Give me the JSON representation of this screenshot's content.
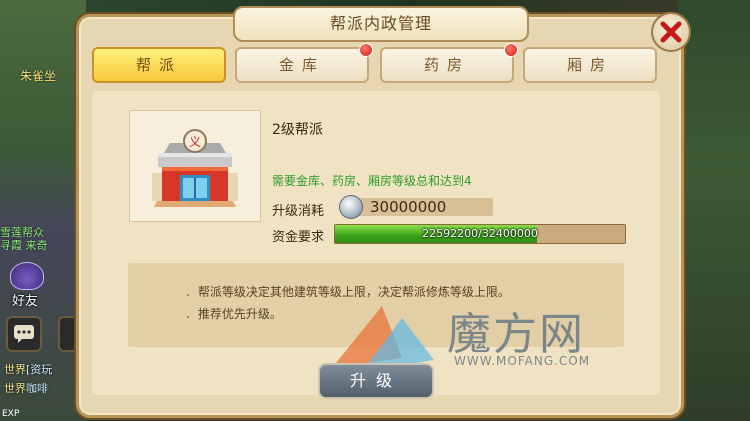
{
  "panel": {
    "title": "帮派内政管理",
    "tabs": [
      {
        "label": "帮派",
        "active": true,
        "has_notification": false
      },
      {
        "label": "金库",
        "active": false,
        "has_notification": true
      },
      {
        "label": "药房",
        "active": false,
        "has_notification": true
      },
      {
        "label": "厢房",
        "active": false,
        "has_notification": false
      }
    ],
    "building": {
      "level_title": "2级帮派",
      "requirement": "需要金库、药房、厢房等级总和达到4",
      "cost_label": "升级消耗",
      "cost_value": "30000000",
      "fund_label": "资金要求",
      "fund_current": 22592200,
      "fund_required": 32400000,
      "fund_text": "22592200/32400000"
    },
    "info": [
      "帮派等级决定其他建筑等级上限，决定帮派修炼等级上限。",
      "推荐优先升级。"
    ],
    "info_bullet": ".",
    "upgrade_label": "升级"
  },
  "hud": {
    "player_name": "朱雀坐",
    "guild_line1": "雪莲帮众",
    "guild_line2": "寻霞 来奇",
    "friend_label": "好友",
    "world_lines": [
      {
        "tag": "世界",
        "msg": "[资玩"
      },
      {
        "tag": "世界",
        "msg": "咖啡"
      }
    ],
    "exp_label": "EXP"
  },
  "watermark": {
    "text": "魔方网",
    "url": "WWW.MOFANG.COM"
  },
  "colors": {
    "accent_gold": "#f6c93a",
    "progress_green": "#3fa81c",
    "requirement_green": "#2e9c2a",
    "notification_red": "#d01818"
  }
}
